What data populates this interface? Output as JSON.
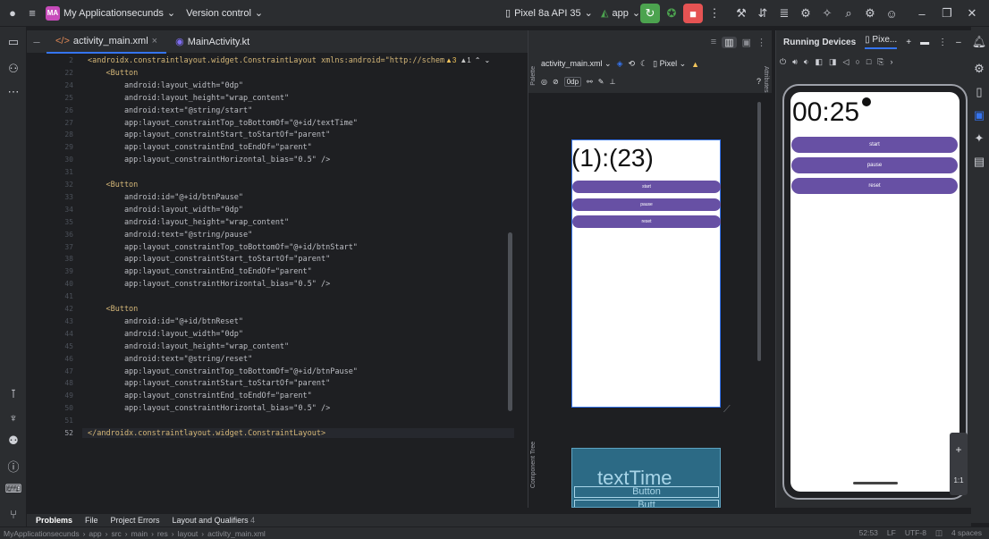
{
  "titlebar": {
    "project_badge": "MA",
    "project_name": "My Applicationsecunds",
    "vcs": "Version control",
    "device": "Pixel 8a API 35",
    "run_config": "app"
  },
  "editor_tabs": [
    {
      "label": "activity_main.xml",
      "close": "×"
    },
    {
      "label": "MainActivity.kt"
    }
  ],
  "editor": {
    "warnings": "▲3",
    "weak_warnings": "▲1",
    "lines": [
      {
        "n": "2",
        "text": "<androidx.constraintlayout.widget.ConstraintLayout xmlns:android=\"http://schem"
      },
      {
        "n": "22",
        "text": "    <Button"
      },
      {
        "n": "24",
        "text": "        android:layout_width=\"0dp\""
      },
      {
        "n": "25",
        "text": "        android:layout_height=\"wrap_content\""
      },
      {
        "n": "26",
        "text": "        android:text=\"@string/start\""
      },
      {
        "n": "27",
        "text": "        app:layout_constraintTop_toBottomOf=\"@+id/textTime\""
      },
      {
        "n": "28",
        "text": "        app:layout_constraintStart_toStartOf=\"parent\""
      },
      {
        "n": "29",
        "text": "        app:layout_constraintEnd_toEndOf=\"parent\""
      },
      {
        "n": "30",
        "text": "        app:layout_constraintHorizontal_bias=\"0.5\" />"
      },
      {
        "n": "31",
        "text": ""
      },
      {
        "n": "32",
        "text": "    <Button"
      },
      {
        "n": "33",
        "text": "        android:id=\"@+id/btnPause\""
      },
      {
        "n": "34",
        "text": "        android:layout_width=\"0dp\""
      },
      {
        "n": "35",
        "text": "        android:layout_height=\"wrap_content\""
      },
      {
        "n": "36",
        "text": "        android:text=\"@string/pause\""
      },
      {
        "n": "37",
        "text": "        app:layout_constraintTop_toBottomOf=\"@+id/btnStart\""
      },
      {
        "n": "38",
        "text": "        app:layout_constraintStart_toStartOf=\"parent\""
      },
      {
        "n": "39",
        "text": "        app:layout_constraintEnd_toEndOf=\"parent\""
      },
      {
        "n": "40",
        "text": "        app:layout_constraintHorizontal_bias=\"0.5\" />"
      },
      {
        "n": "41",
        "text": ""
      },
      {
        "n": "42",
        "text": "    <Button"
      },
      {
        "n": "43",
        "text": "        android:id=\"@+id/btnReset\""
      },
      {
        "n": "44",
        "text": "        android:layout_width=\"0dp\""
      },
      {
        "n": "45",
        "text": "        android:layout_height=\"wrap_content\""
      },
      {
        "n": "46",
        "text": "        android:text=\"@string/reset\""
      },
      {
        "n": "47",
        "text": "        app:layout_constraintTop_toBottomOf=\"@+id/btnPause\""
      },
      {
        "n": "48",
        "text": "        app:layout_constraintStart_toStartOf=\"parent\""
      },
      {
        "n": "49",
        "text": "        app:layout_constraintEnd_toEndOf=\"parent\""
      },
      {
        "n": "50",
        "text": "        app:layout_constraintHorizontal_bias=\"0.5\" />"
      },
      {
        "n": "51",
        "text": ""
      },
      {
        "n": "52",
        "text": "</androidx.constraintlayout.widget.ConstraintLayout>"
      }
    ]
  },
  "design": {
    "file_dropdown": "activity_main.xml",
    "device_dropdown": "Pixel",
    "dp_label": "0dp",
    "help": "?",
    "palette_label": "Palette",
    "attributes_label": "Attributes",
    "component_tree_label": "Component Tree",
    "preview_text": "(1):(23)",
    "preview_buttons": [
      "start",
      "pause",
      "reset"
    ],
    "blueprint_text": "textTime",
    "blueprint_button": "Button",
    "blueprint_button2": "Butt"
  },
  "running": {
    "title": "Running Devices",
    "device_tab": "Pixe...",
    "timer": "00:25",
    "buttons": [
      "start",
      "pause",
      "reset"
    ],
    "zoom_plus": "+",
    "zoom_ratio": "1:1"
  },
  "bottom": {
    "tabs": [
      "Problems",
      "File",
      "Project Errors",
      "Layout and Qualifiers"
    ],
    "layout_count": "4"
  },
  "status": {
    "breadcrumb": [
      "MyApplicationsecunds",
      "app",
      "src",
      "main",
      "res",
      "layout",
      "activity_main.xml"
    ],
    "position": "52:53",
    "line_sep": "LF",
    "encoding": "UTF-8",
    "indent": "4 spaces"
  },
  "colors": {
    "accent": "#3574f0",
    "button_purple": "#6750a4",
    "run_green": "#4ca34f",
    "stop_red": "#e55353"
  }
}
